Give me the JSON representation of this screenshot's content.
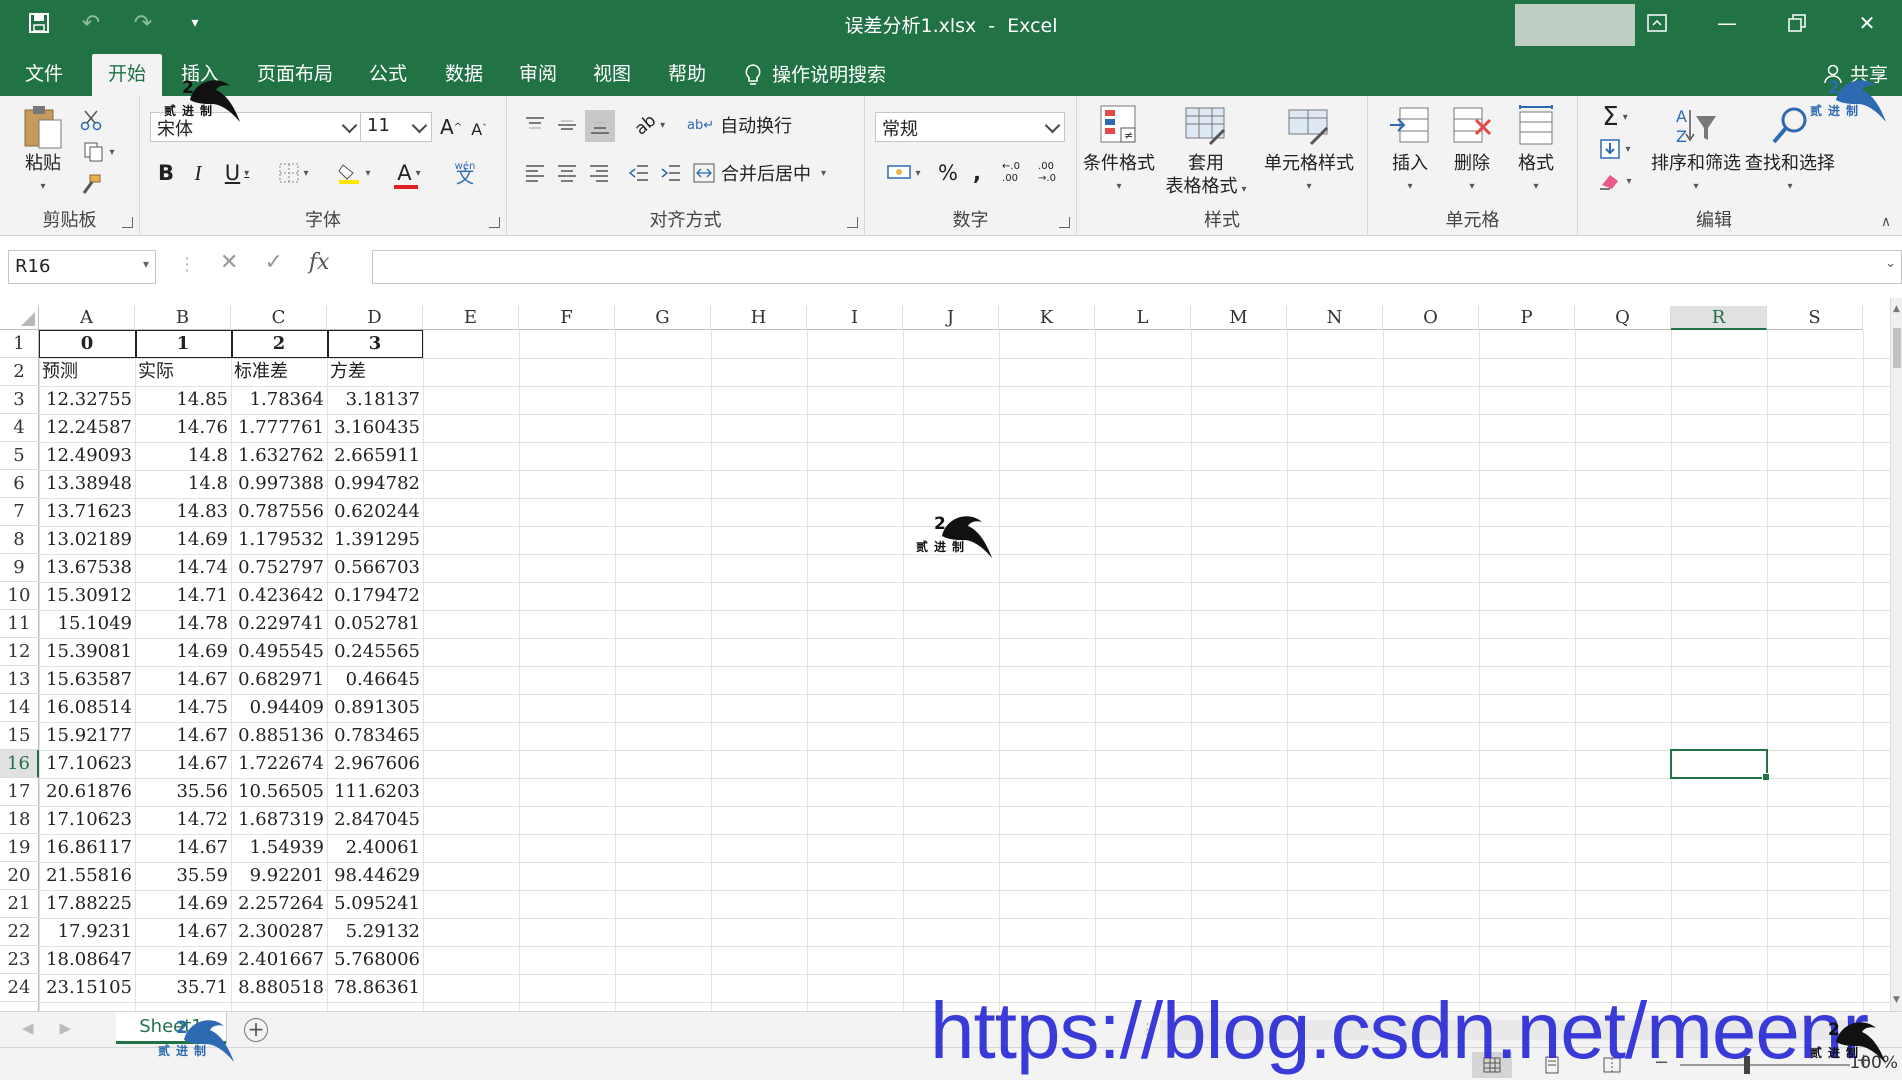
{
  "title_bar": {
    "filename": "误差分析1.xlsx",
    "separator": "-",
    "app": "Excel",
    "qat": [
      "save-icon",
      "undo-icon",
      "redo-icon",
      "customize-icon"
    ]
  },
  "tabs": [
    {
      "label": "文件"
    },
    {
      "label": "开始"
    },
    {
      "label": "插入"
    },
    {
      "label": "页面布局"
    },
    {
      "label": "公式"
    },
    {
      "label": "数据"
    },
    {
      "label": "审阅"
    },
    {
      "label": "视图"
    },
    {
      "label": "帮助"
    },
    {
      "label": "操作说明搜索"
    }
  ],
  "active_tab": "开始",
  "share_label": "共享",
  "ribbon": {
    "clipboard": {
      "label": "剪贴板",
      "paste": "粘贴"
    },
    "font": {
      "label": "字体",
      "font_name": "宋体",
      "font_size": "11"
    },
    "alignment": {
      "label": "对齐方式",
      "wrap": "自动换行",
      "merge": "合并后居中"
    },
    "number": {
      "label": "数字",
      "format": "常规"
    },
    "styles": {
      "label": "样式",
      "conditional": "条件格式",
      "table1": "套用",
      "table2": "表格格式",
      "cell_styles": "单元格样式"
    },
    "cells": {
      "label": "单元格",
      "insert": "插入",
      "delete": "删除",
      "format": "格式"
    },
    "editing": {
      "label": "编辑",
      "sort": "排序和筛选",
      "find": "查找和选择"
    }
  },
  "formula_bar": {
    "name_box": "R16",
    "fx": "fx",
    "value": ""
  },
  "columns": [
    "A",
    "B",
    "C",
    "D",
    "E",
    "F",
    "G",
    "H",
    "I",
    "J",
    "K",
    "L",
    "M",
    "N",
    "O",
    "P",
    "Q",
    "R",
    "S"
  ],
  "selected_col": "R",
  "selected_row": "16",
  "rows": [
    [
      "1",
      "0",
      "1",
      "2",
      "3"
    ],
    [
      "2",
      "预测",
      "实际",
      "标准差",
      "方差"
    ],
    [
      "3",
      "12.32755",
      "14.85",
      "1.78364",
      "3.18137"
    ],
    [
      "4",
      "12.24587",
      "14.76",
      "1.777761",
      "3.160435"
    ],
    [
      "5",
      "12.49093",
      "14.8",
      "1.632762",
      "2.665911"
    ],
    [
      "6",
      "13.38948",
      "14.8",
      "0.997388",
      "0.994782"
    ],
    [
      "7",
      "13.71623",
      "14.83",
      "0.787556",
      "0.620244"
    ],
    [
      "8",
      "13.02189",
      "14.69",
      "1.179532",
      "1.391295"
    ],
    [
      "9",
      "13.67538",
      "14.74",
      "0.752797",
      "0.566703"
    ],
    [
      "10",
      "15.30912",
      "14.71",
      "0.423642",
      "0.179472"
    ],
    [
      "11",
      "15.1049",
      "14.78",
      "0.229741",
      "0.052781"
    ],
    [
      "12",
      "15.39081",
      "14.69",
      "0.495545",
      "0.245565"
    ],
    [
      "13",
      "15.63587",
      "14.67",
      "0.682971",
      "0.46645"
    ],
    [
      "14",
      "16.08514",
      "14.75",
      "0.94409",
      "0.891305"
    ],
    [
      "15",
      "15.92177",
      "14.67",
      "0.885136",
      "0.783465"
    ],
    [
      "16",
      "17.10623",
      "14.67",
      "1.722674",
      "2.967606"
    ],
    [
      "17",
      "20.61876",
      "35.56",
      "10.56505",
      "111.6203"
    ],
    [
      "18",
      "17.10623",
      "14.72",
      "1.687319",
      "2.847045"
    ],
    [
      "19",
      "16.86117",
      "14.67",
      "1.54939",
      "2.40061"
    ],
    [
      "20",
      "21.55816",
      "35.59",
      "9.92201",
      "98.44629"
    ],
    [
      "21",
      "17.88225",
      "14.69",
      "2.257264",
      "5.095241"
    ],
    [
      "22",
      "17.9231",
      "14.67",
      "2.300287",
      "5.29132"
    ],
    [
      "23",
      "18.08647",
      "14.69",
      "2.401667",
      "5.768006"
    ],
    [
      "24",
      "23.15105",
      "35.71",
      "8.880518",
      "78.86361"
    ]
  ],
  "sheet_tabs": [
    {
      "label": "Sheet1"
    }
  ],
  "status": {
    "zoom": "100%"
  },
  "watermark": {
    "url": "https://blog.csdn.net/meenr",
    "logo_two": "2",
    "logo_text": "贰进制"
  }
}
